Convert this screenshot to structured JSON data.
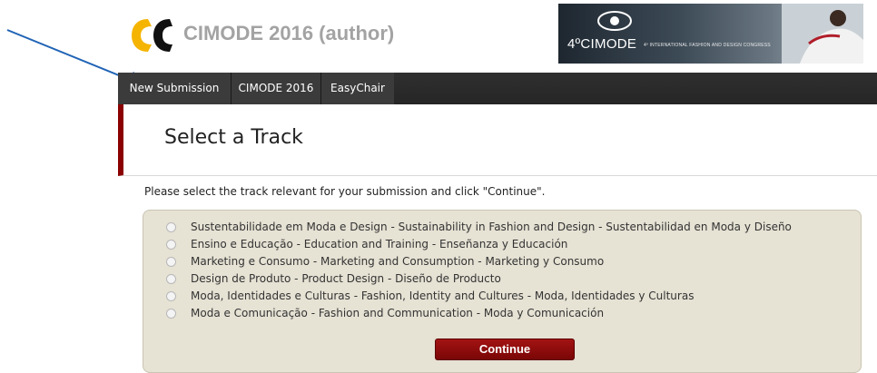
{
  "header": {
    "app_title": "CIMODE 2016 (author)",
    "banner_title": "4ºCIMODE",
    "banner_subtitle": "4º INTERNATIONAL FASHION AND DESIGN CONGRESS"
  },
  "menu": {
    "items": [
      {
        "label": "New Submission"
      },
      {
        "label": "CIMODE 2016"
      },
      {
        "label": "EasyChair"
      }
    ]
  },
  "page": {
    "title": "Select a Track",
    "instructions": "Please select the track relevant for your submission and click \"Continue\"."
  },
  "tracks": [
    {
      "label": "Sustentabilidade em Moda e Design - Sustainability in Fashion and Design - Sustentabilidad en Moda y Diseño"
    },
    {
      "label": "Ensino e Educação - Education and Training - Enseñanza y Educación"
    },
    {
      "label": "Marketing e Consumo - Marketing and Consumption - Marketing y Consumo"
    },
    {
      "label": "Design de Produto - Product Design - Diseño de Producto"
    },
    {
      "label": "Moda, Identidades e Culturas - Fashion, Identity and Cultures - Moda, Identidades y Culturas"
    },
    {
      "label": "Moda e Comunicação - Fashion and Communication - Moda y Comunicación"
    }
  ],
  "continue_label": "Continue",
  "colors": {
    "accent": "#8b0000",
    "logo_yellow": "#f5b400",
    "logo_black": "#111111",
    "menubar": "#2b2b2b",
    "arrow": "#1f63b5"
  },
  "icons": {
    "logo": "easychair-logo-icon",
    "arrow": "pointer-arrow-icon"
  }
}
